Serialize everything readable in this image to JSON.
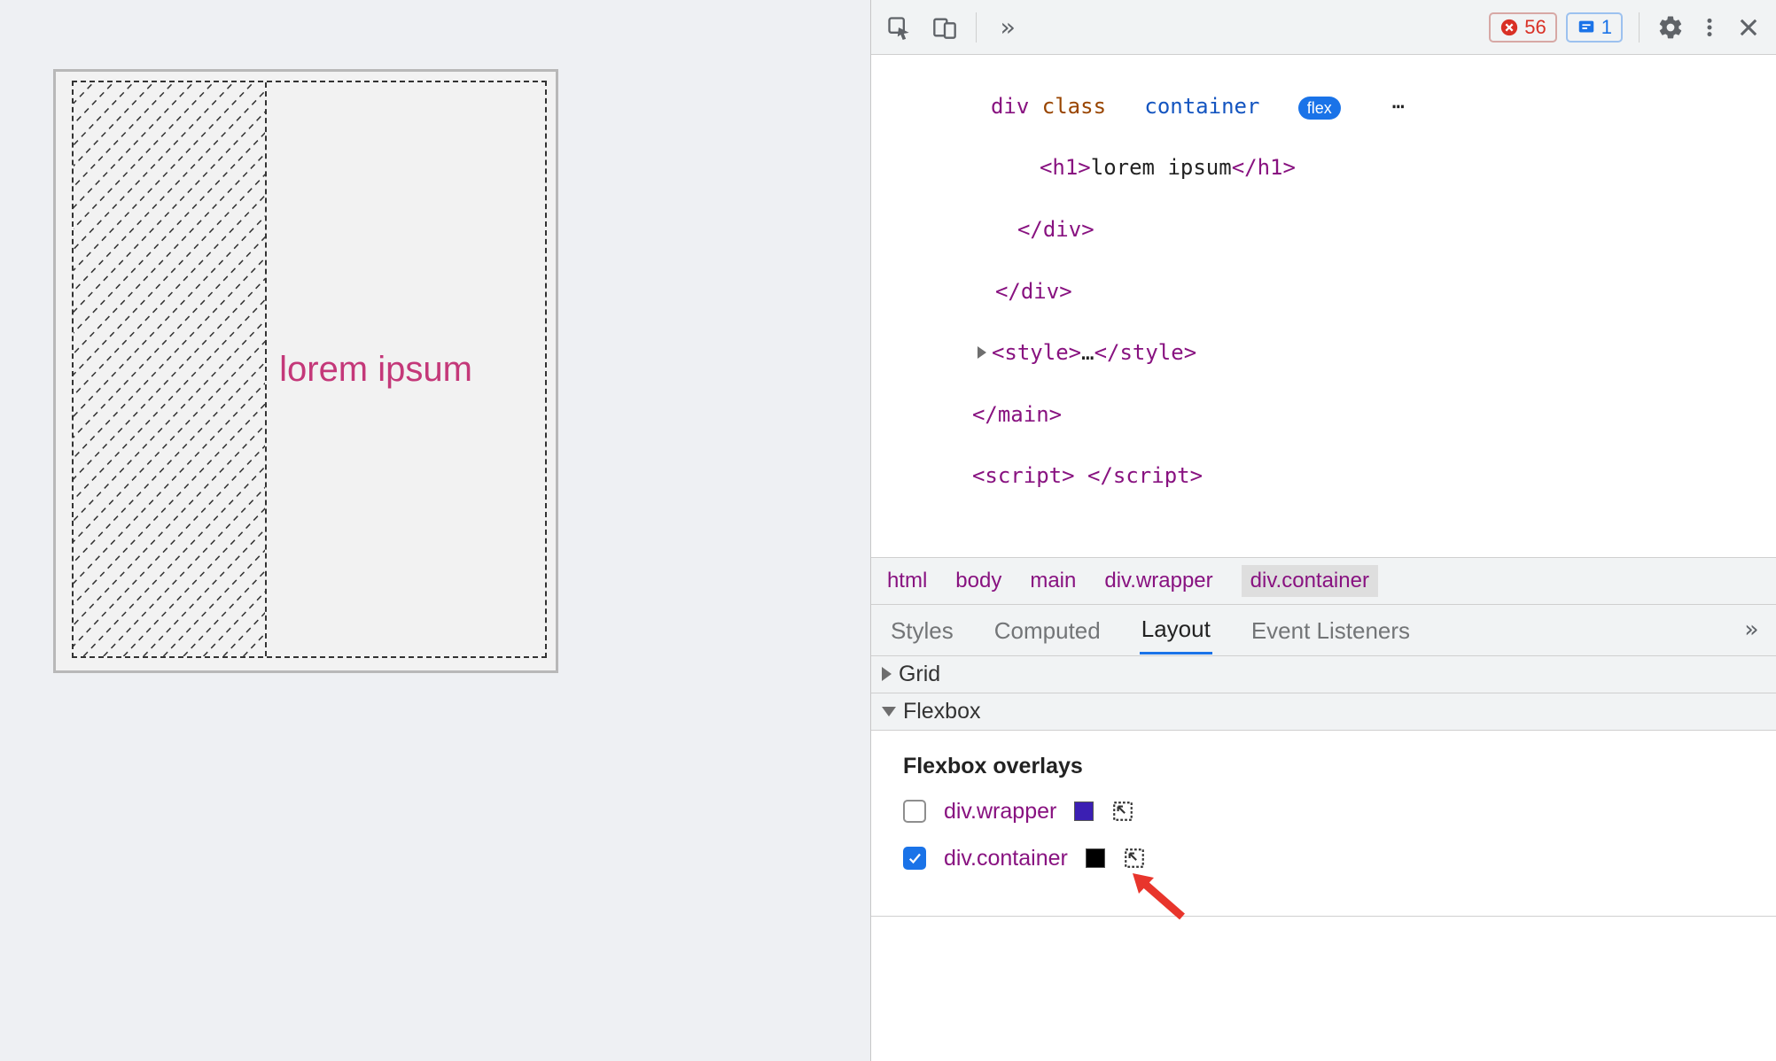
{
  "preview": {
    "heading": "lorem ipsum"
  },
  "toolbar": {
    "errors_count": "56",
    "issues_count": "1"
  },
  "elements": {
    "trunc_left": "…",
    "flex_badge": "flex",
    "dots": "⋯",
    "line_h1_open": "<h1>",
    "line_h1_text": "lorem ipsum",
    "line_h1_close": "</h1>",
    "line_close_div1": "</div>",
    "line_close_div2": "</div>",
    "line_style_open": "<style>",
    "line_style_ell": "…",
    "line_style_close": "</style>",
    "line_close_main": "</main>",
    "line_script": "<script> </script>"
  },
  "breadcrumb": {
    "items": [
      {
        "label": "html"
      },
      {
        "label": "body"
      },
      {
        "label": "main"
      },
      {
        "label": "div.wrapper"
      },
      {
        "label": "div.container",
        "selected": true
      }
    ]
  },
  "pane_tabs": {
    "styles": "Styles",
    "computed": "Computed",
    "layout": "Layout",
    "event_listeners": "Event Listeners"
  },
  "layout": {
    "grid_label": "Grid",
    "flexbox_label": "Flexbox",
    "overlays_title": "Flexbox overlays",
    "rows": [
      {
        "label": "div.wrapper",
        "checked": false,
        "swatch_color": "indigo"
      },
      {
        "label": "div.container",
        "checked": true,
        "swatch_color": "black"
      }
    ]
  }
}
